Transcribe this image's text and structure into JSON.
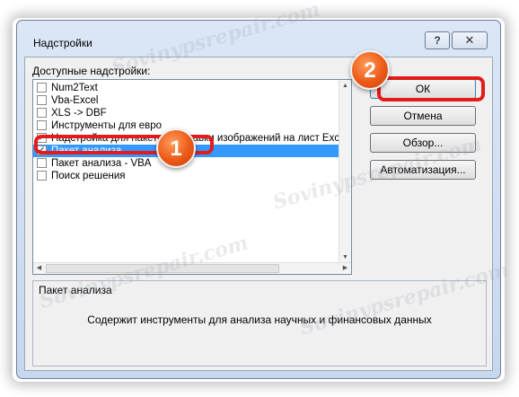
{
  "window": {
    "title": "Надстройки",
    "help_label": "?",
    "close_label": "✕"
  },
  "list": {
    "label": "Доступные надстройки:",
    "items": [
      {
        "label": "Num2Text",
        "checked": false,
        "selected": false
      },
      {
        "label": "Vba-Excel",
        "checked": false,
        "selected": false
      },
      {
        "label": "XLS -> DBF",
        "checked": false,
        "selected": false
      },
      {
        "label": "Инструменты для евро",
        "checked": false,
        "selected": false
      },
      {
        "label": "Надстройка для пакетной вставки изображений на лист Excel",
        "checked": true,
        "selected": false
      },
      {
        "label": "Пакет анализа",
        "checked": true,
        "selected": true
      },
      {
        "label": "Пакет анализа - VBA",
        "checked": false,
        "selected": false
      },
      {
        "label": "Поиск решения",
        "checked": false,
        "selected": false
      }
    ]
  },
  "buttons": {
    "ok": "ОК",
    "cancel": "Отмена",
    "browse": "Обзор...",
    "automation": "Автоматизация..."
  },
  "description": {
    "name": "Пакет анализа",
    "text": "Содержит инструменты для анализа научных и финансовых данных"
  },
  "annotations": {
    "badge_1": "1",
    "badge_2": "2",
    "highlight_color": "#e31b1b",
    "badge_color": "#ec5a17"
  },
  "watermark": "Sovinypsrepair.com",
  "check_mark": "✓"
}
